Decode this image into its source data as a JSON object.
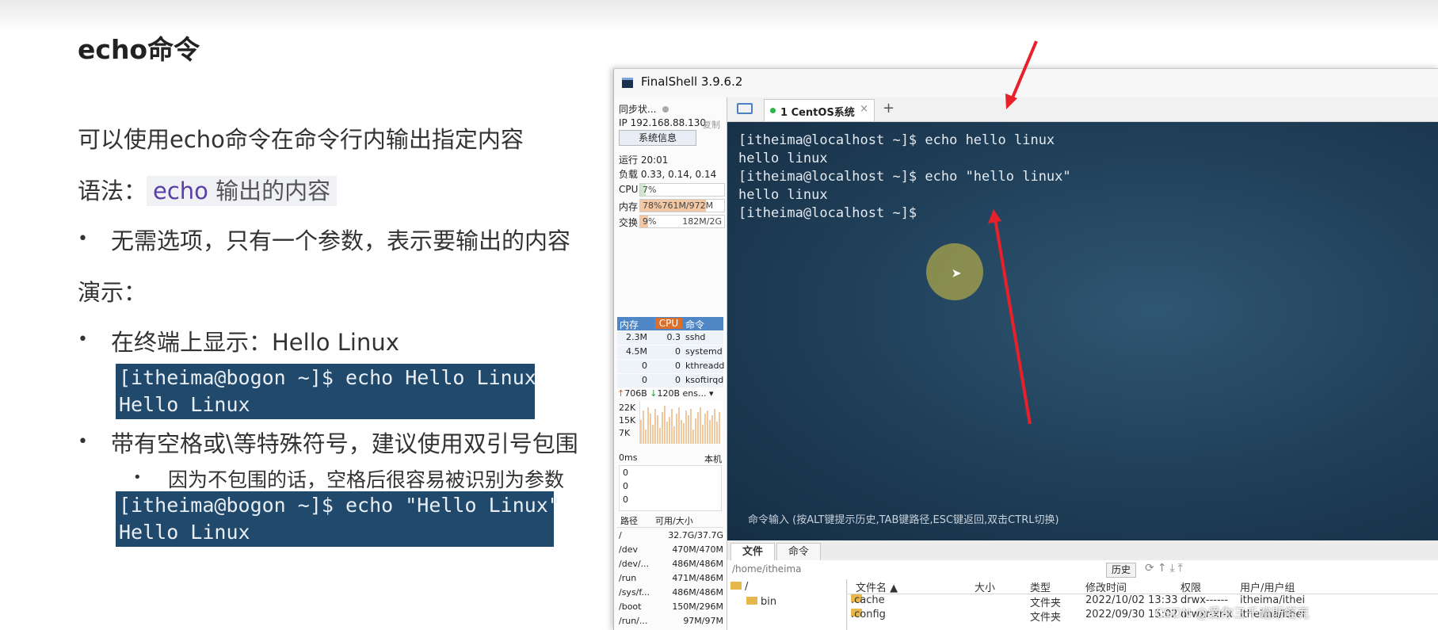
{
  "slide": {
    "title": "echo命令",
    "intro": "可以使用echo命令在命令行内输出指定内容",
    "syntax_label": "语法：",
    "syntax_code": "echo",
    "syntax_rest": "输出的内容",
    "bullet1": "无需选项，只有一个参数，表示要输出的内容",
    "demo_label": "演示：",
    "bullet2": "在终端上显示：Hello Linux",
    "code1_line1": "[itheima@bogon ~]$ echo Hello Linux",
    "code1_line2": "Hello Linux",
    "bullet3": "带有空格或\\等特殊符号，建议使用双引号包围",
    "subbullet": "因为不包围的话，空格后很容易被识别为参数",
    "code2_line1": "[itheima@bogon ~]$ echo \"Hello Linux\"",
    "code2_line2": "Hello Linux"
  },
  "finalshell": {
    "title": "FinalShell 3.9.6.2",
    "left": {
      "sync": "同步状...",
      "ip": "IP 192.168.88.130",
      "copy": "复制",
      "sysinfo": "系统信息",
      "uptime": "运行 20:01",
      "load": "负载 0.33, 0.14, 0.14",
      "cpu_label": "CPU",
      "cpu_value": "7%",
      "cpu_pct": 7,
      "mem_label": "内存",
      "mem_value": "78%761M/972M",
      "mem_pct": 78,
      "swap_label": "交换",
      "swap_value": "9%",
      "swap_size": "182M/2G",
      "swap_pct": 9,
      "proc_headers": [
        "内存",
        "CPU",
        "命令"
      ],
      "processes": [
        {
          "mem": "2.3M",
          "cpu": "0.3",
          "cmd": "sshd"
        },
        {
          "mem": "4.5M",
          "cpu": "0",
          "cmd": "systemd"
        },
        {
          "mem": "0",
          "cpu": "0",
          "cmd": "kthreadd"
        },
        {
          "mem": "0",
          "cpu": "0",
          "cmd": "ksoftirqd"
        }
      ],
      "net_up": "706B",
      "net_down": "120B",
      "net_iface": "ens...",
      "net_scale": [
        "22K",
        "15K",
        "7K"
      ],
      "latency": "0ms",
      "latency_host": "本机",
      "latency_vals": [
        "0",
        "0",
        "0"
      ],
      "disk_headers": [
        "路径",
        "可用/大小"
      ],
      "disks": [
        {
          "path": "/",
          "size": "32.7G/37.7G"
        },
        {
          "path": "/dev",
          "size": "470M/470M"
        },
        {
          "path": "/dev/...",
          "size": "486M/486M"
        },
        {
          "path": "/run",
          "size": "471M/486M"
        },
        {
          "path": "/sys/f...",
          "size": "486M/486M"
        },
        {
          "path": "/boot",
          "size": "150M/296M"
        },
        {
          "path": "/run/...",
          "size": "97M/97M"
        },
        {
          "path": "/run/...",
          "size": "97M/97M"
        }
      ]
    },
    "tab_label": "1 CentOS系统",
    "tab_close": "×",
    "tab_add": "+",
    "terminal_lines": [
      "[itheima@localhost ~]$ echo hello linux",
      "hello linux",
      "[itheima@localhost ~]$ echo \"hello linux\"",
      "hello linux",
      "[itheima@localhost ~]$"
    ],
    "cmd_hint": "命令输入 (按ALT键提示历史,TAB键路径,ESC键返回,双击CTRL切换)",
    "bottom_tabs": [
      "文件",
      "命令"
    ],
    "path": "/home/itheima",
    "history_btn": "历史",
    "tree": [
      "/",
      "bin"
    ],
    "file_headers": [
      "文件名 ▲",
      "大小",
      "类型",
      "修改时间",
      "权限",
      "用户/用户组"
    ],
    "files": [
      {
        "name": ".cache",
        "type": "文件夹",
        "mtime": "2022/10/02 13:33",
        "perm": "drwx------",
        "owner": "itheima/ithei"
      },
      {
        "name": ".config",
        "type": "文件夹",
        "mtime": "2022/09/30 15:02",
        "perm": "drwxr-xr-x",
        "owner": "itheima/ithei"
      }
    ]
  },
  "watermark": "CSDN @爱你三千遍斯塔克",
  "colors": {
    "arrow": "#e8202a",
    "code_bg": "#21496b",
    "terminal_bg": "#1f3e57"
  }
}
